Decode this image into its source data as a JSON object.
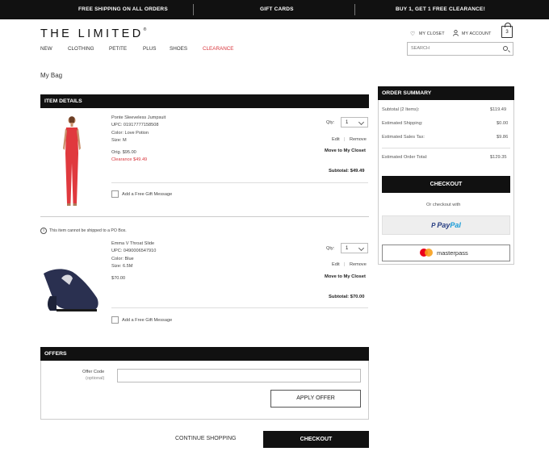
{
  "promo": {
    "left": "FREE SHIPPING ON ALL ORDERS",
    "center": "GIFT CARDS",
    "right": "BUY 1, GET 1 FREE CLEARANCE!"
  },
  "brand": {
    "logo": "THE LIMITED",
    "mark": "®"
  },
  "nav": {
    "items": [
      "NEW",
      "CLOTHING",
      "PETITE",
      "PLUS",
      "SHOES"
    ],
    "clearance": "CLEARANCE"
  },
  "utility": {
    "closet": "MY CLOSET",
    "account": "MY ACCOUNT",
    "bag_count": "3",
    "search_placeholder": "SEARCH"
  },
  "page": {
    "title": "My Bag"
  },
  "item_details": {
    "heading": "ITEM DETAILS",
    "qty_label": "Qty:",
    "edit": "Edit",
    "sep": "|",
    "remove": "Remove",
    "move": "Move to My Closet",
    "gift": "Add a Free Gift Message",
    "items": [
      {
        "name": "Ponte Sleeveless Jumpsuit",
        "upc": "UPC: 01917777158508",
        "color": "Color: Love Potion",
        "size": "Size: M",
        "orig": "Orig. $95.00",
        "clearance": "Clearance $49.49",
        "qty": "1",
        "subtotal": "Subtotal: $49.49",
        "color_hex": "#e0393e"
      },
      {
        "notice": "This item cannot be shipped to a PO Box.",
        "name": "Emma V Throat Slide",
        "upc": "UPC: 0490006547910",
        "color": "Color: Blue",
        "size": "Size: 6.5M",
        "price": "$70.00",
        "qty": "1",
        "subtotal": "Subtotal: $70.00",
        "color_hex": "#2a3050"
      }
    ]
  },
  "offers": {
    "heading": "OFFERS",
    "code_label": "Offer Code",
    "code_optional": "(optional)",
    "apply": "APPLY OFFER"
  },
  "footer_actions": {
    "continue": "CONTINUE SHOPPING",
    "checkout": "CHECKOUT"
  },
  "summary": {
    "heading": "ORDER SUMMARY",
    "rows": [
      {
        "label": "Subtotal (2 Items):",
        "value": "$119.49"
      },
      {
        "label": "Estimated Shipping:",
        "value": "$0.00"
      },
      {
        "label": "Estimated Sales Tax:",
        "value": "$9.86"
      },
      {
        "label": "Estimated Order Total:",
        "value": "$129.35"
      }
    ],
    "checkout": "CHECKOUT",
    "or_text": "Or checkout with",
    "paypal_a": "Pay",
    "paypal_b": "Pal",
    "masterpass": "masterpass"
  },
  "colors": {
    "accent_red": "#d8333a",
    "black": "#111111"
  }
}
